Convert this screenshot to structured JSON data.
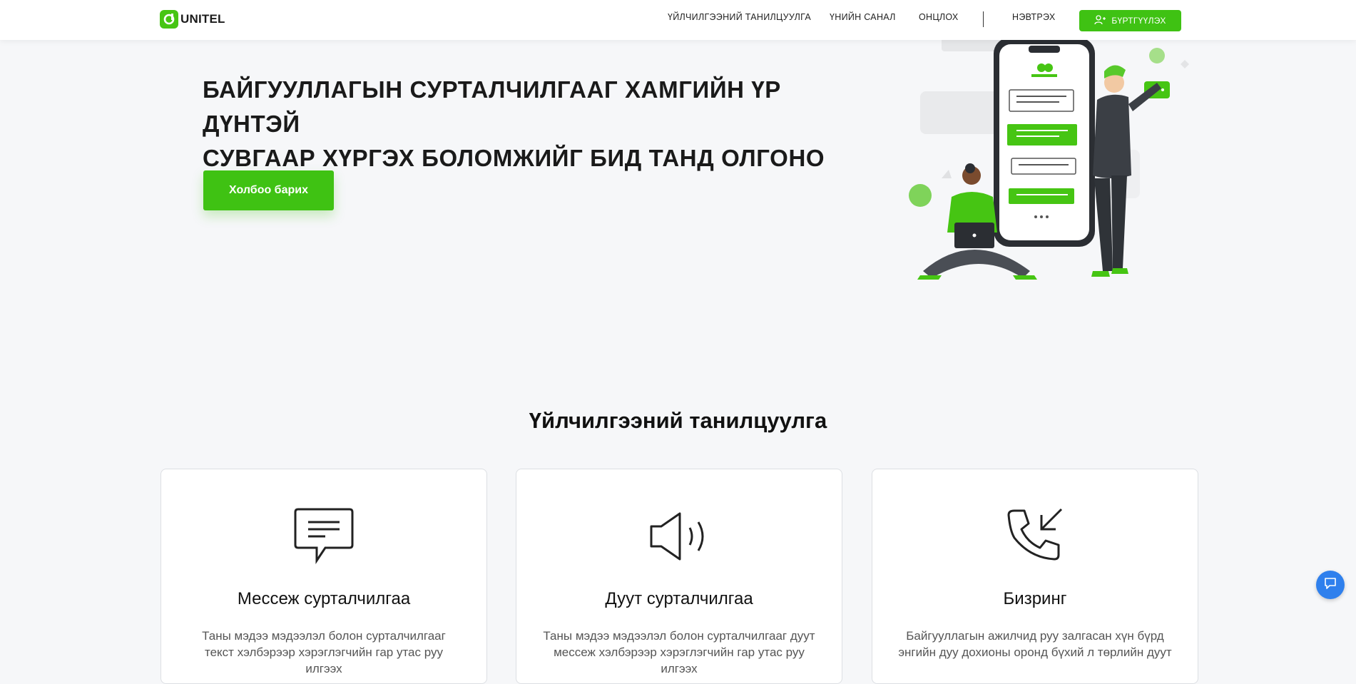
{
  "header": {
    "logo_text": "UNITEL",
    "nav": [
      {
        "label": "ҮЙЛЧИЛГЭЭНИЙ ТАНИЛЦУУЛГА"
      },
      {
        "label": "ҮНИЙН САНАЛ"
      },
      {
        "label": "ОНЦЛОХ"
      },
      {
        "label": "НЭВТРЭХ"
      }
    ],
    "register_label": "БҮРТГҮҮЛЭХ"
  },
  "hero": {
    "title_line1": "БАЙГУУЛЛАГЫН СУРТАЛЧИЛГААГ ХАМГИЙН ҮР ДҮНТЭЙ",
    "title_line2": "СУВГААР ХҮРГЭХ БОЛОМЖИЙГ БИД ТАНД ОЛГОНО",
    "contact_label": "Холбоо барих"
  },
  "services": {
    "title": "Үйлчилгээний танилцуулга",
    "cards": [
      {
        "icon": "message-icon",
        "title": "Мессеж сурталчилгаа",
        "desc": "Таны мэдээ мэдээлэл болон сурталчилгааг текст хэлбэрээр хэрэглэгчийн гар утас руу илгээх"
      },
      {
        "icon": "speaker-icon",
        "title": "Дуут сурталчилгаа",
        "desc": "Таны мэдээ мэдээлэл болон сурталчилгааг дуут мессеж хэлбэрээр хэрэглэгчийн гар утас руу илгээх"
      },
      {
        "icon": "incoming-call-icon",
        "title": "Бизринг",
        "desc": "Байгууллагын ажилчид руу залгасан хүн бүрд энгийн дуу дохионы оронд бүхий л төрлийн дуут"
      }
    ]
  },
  "colors": {
    "brand_green": "#3fc213",
    "chat_blue": "#2f80ed"
  }
}
